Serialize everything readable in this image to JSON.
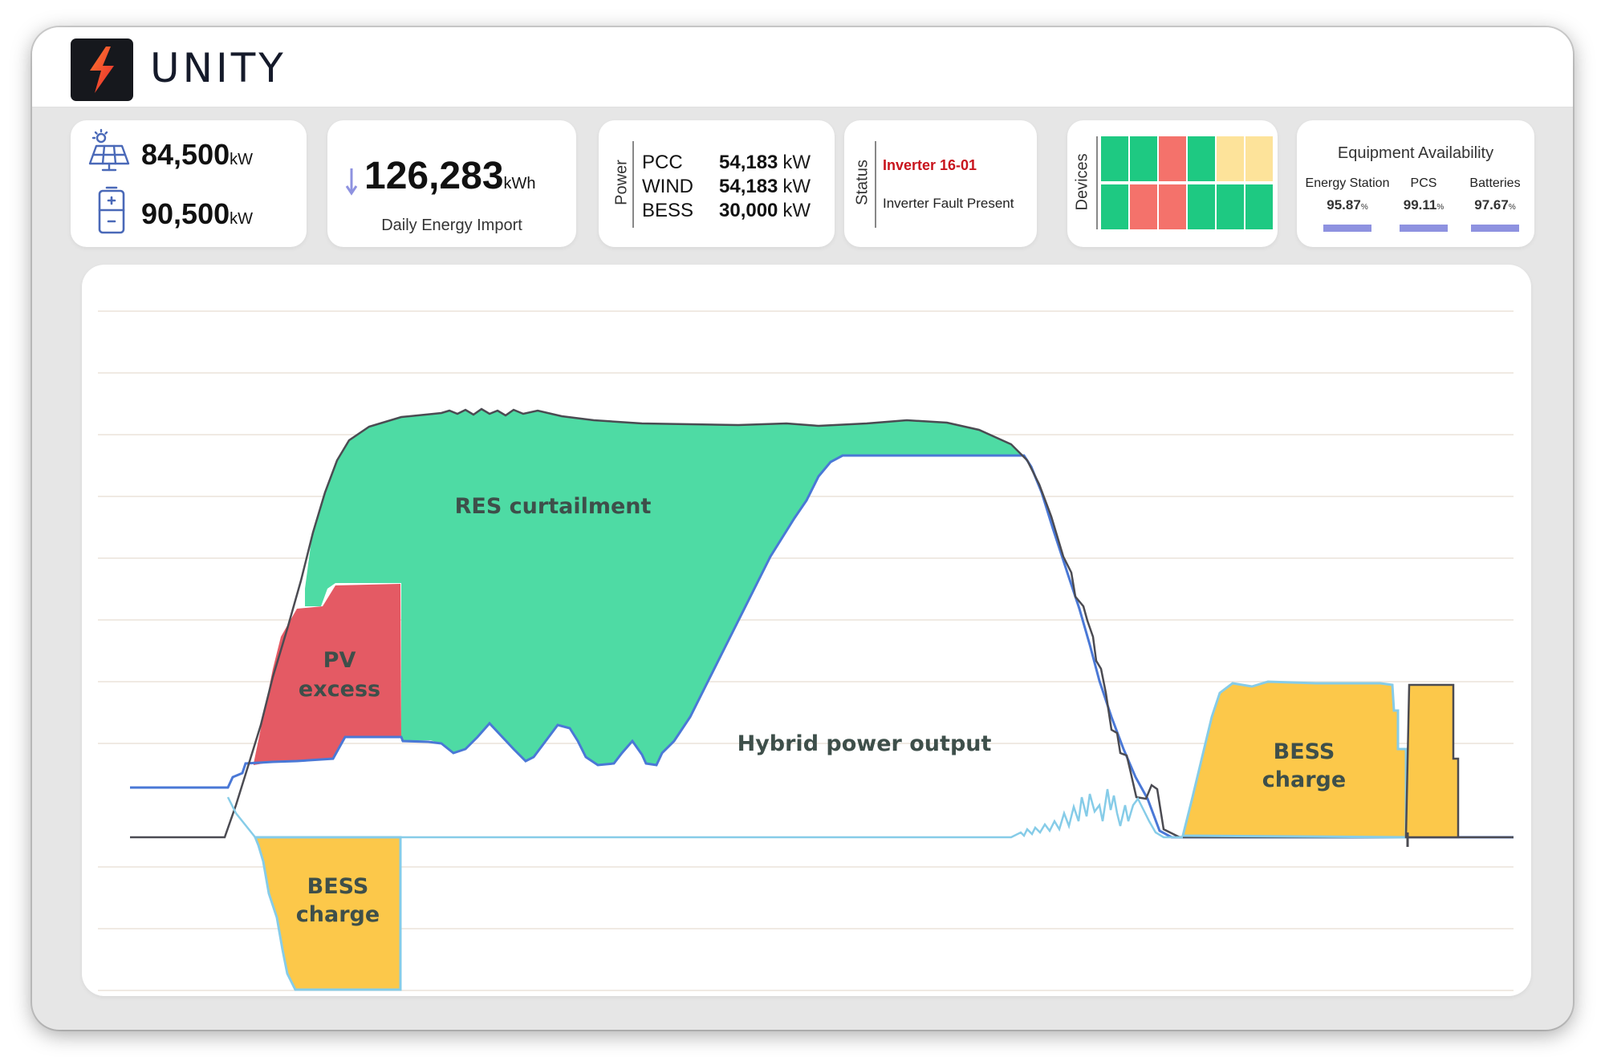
{
  "brand": {
    "name": "UNITY"
  },
  "colors": {
    "res_curtailment": "#4edba4",
    "pv_excess": "#e45a64",
    "bess_charge": "#fcc84a",
    "hybrid_line": "#4a78d6",
    "available_line": "#4b4b52",
    "bess_line": "#86cce8",
    "device_ok": "#1ec982",
    "device_fault": "#f4726b",
    "device_warn": "#fde39a",
    "availability_bar": "#8e92e0"
  },
  "generation": {
    "pv": {
      "icon": "solar-panel-icon",
      "value": "84,500",
      "unit": "kW"
    },
    "battery": {
      "icon": "battery-icon",
      "value": "90,500",
      "unit": "kW"
    }
  },
  "energy_import": {
    "icon": "arrow-down-icon",
    "value": "126,283",
    "unit": "kWh",
    "label": "Daily Energy Import"
  },
  "power": {
    "label": "Power",
    "rows": [
      {
        "name": "PCC",
        "value": "54,183",
        "unit": "kW"
      },
      {
        "name": "WIND",
        "value": "54,183",
        "unit": "kW"
      },
      {
        "name": "BESS",
        "value": "30,000",
        "unit": "kW"
      }
    ]
  },
  "status": {
    "label": "Status",
    "title": "Inverter 16-01",
    "message": "Inverter Fault Present"
  },
  "devices": {
    "label": "Devices",
    "rows": [
      [
        "ok",
        "ok",
        "fault",
        "ok",
        "warn",
        "warn"
      ],
      [
        "ok",
        "fault",
        "fault",
        "ok",
        "ok",
        "ok"
      ]
    ]
  },
  "availability": {
    "title": "Equipment Availability",
    "items": [
      {
        "name": "Energy Station",
        "value": "95.87",
        "unit": "%"
      },
      {
        "name": "PCS",
        "value": "99.11",
        "unit": "%"
      },
      {
        "name": "Batteries",
        "value": "97.67",
        "unit": "%"
      }
    ]
  },
  "chart": {
    "labels": {
      "res_curtailment": "RES curtailment",
      "pv_excess_1": "PV",
      "pv_excess_2": "excess",
      "hybrid_output": "Hybrid power output",
      "bess_charge_left_1": "BESS",
      "bess_charge_left_2": "charge",
      "bess_charge_right_1": "BESS",
      "bess_charge_right_2": "charge"
    }
  }
}
